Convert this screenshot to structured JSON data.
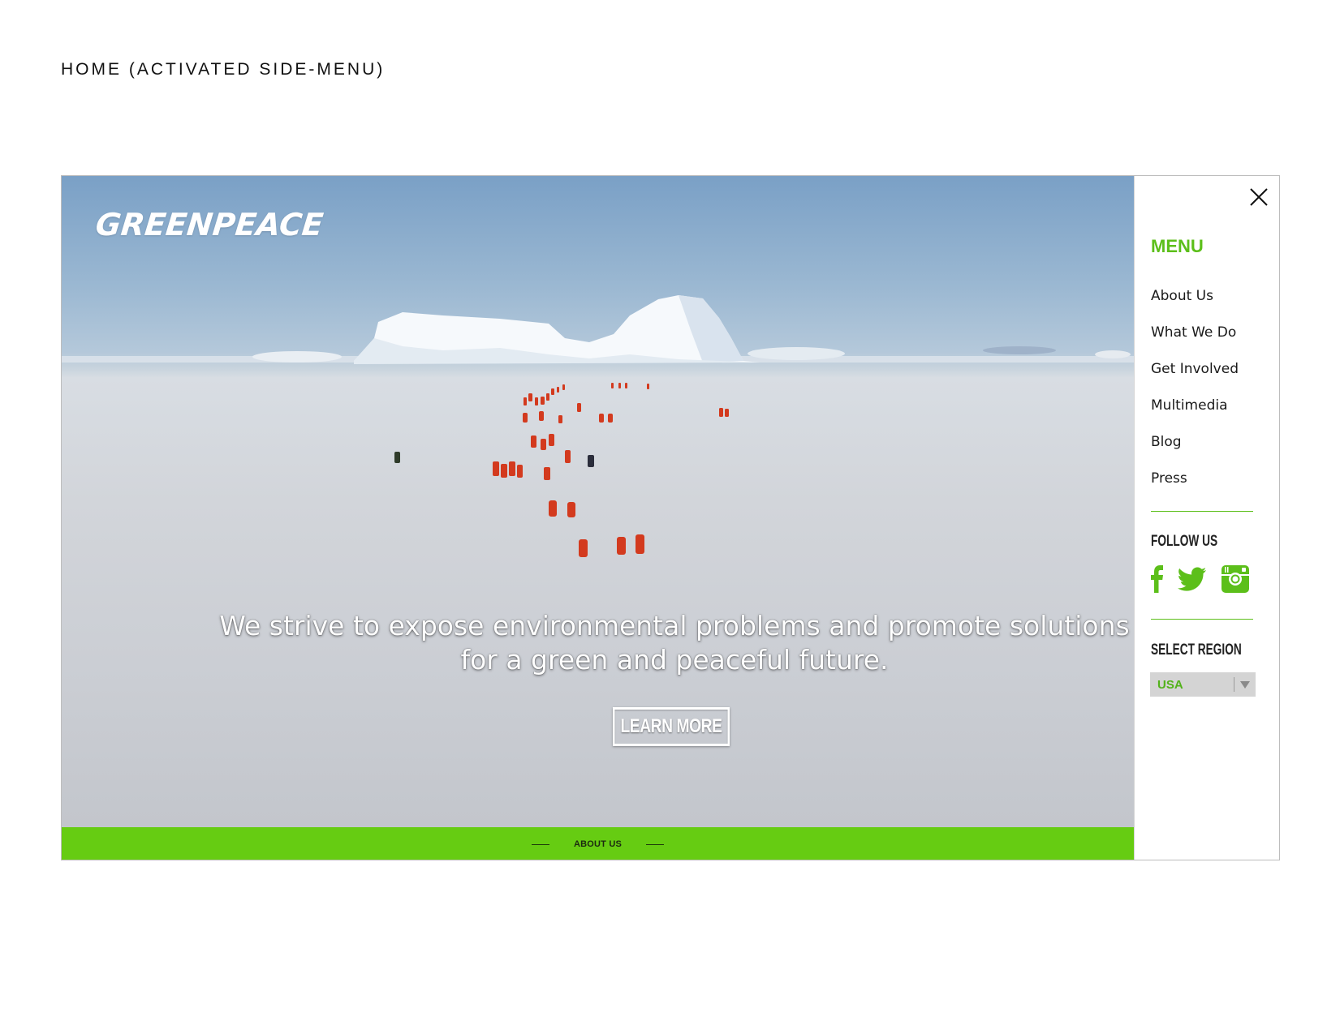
{
  "page": {
    "label": "HOME (ACTIVATED SIDE-MENU)"
  },
  "hero": {
    "logo_text": "GREENPEACE",
    "tagline": "We strive to expose environmental problems and promote solutions for a green and peaceful future.",
    "cta_label": "LEARN MORE"
  },
  "footer_bar": {
    "label": "ABOUT US",
    "color": "#66cc12"
  },
  "side_menu": {
    "title": "MENU",
    "items": [
      {
        "label": "About Us"
      },
      {
        "label": "What We Do"
      },
      {
        "label": "Get Involved"
      },
      {
        "label": "Multimedia"
      },
      {
        "label": "Blog"
      },
      {
        "label": "Press"
      }
    ],
    "follow_heading": "FOLLOW US",
    "social_icons": [
      "facebook-icon",
      "twitter-icon",
      "instagram-icon"
    ],
    "region_heading": "SELECT REGION",
    "region_value": "USA",
    "accent_color": "#5cbf1a"
  }
}
